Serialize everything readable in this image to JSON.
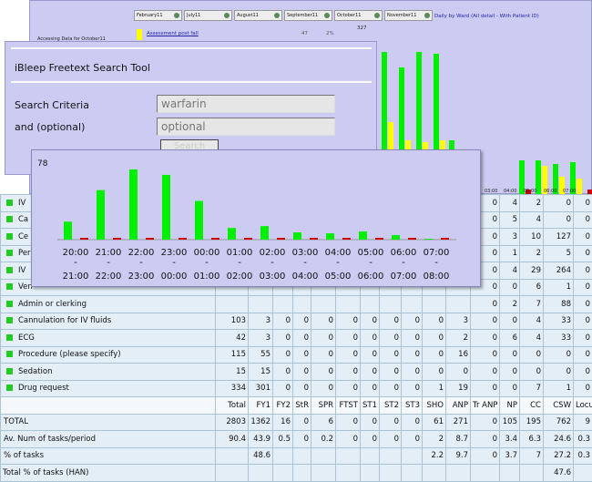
{
  "report": {
    "months": [
      "February11",
      "July11",
      "August11",
      "September11",
      "October11",
      "November11"
    ],
    "ward_link": "Daily by Ward (All detail - With Patient ID)",
    "accessing": "Accessing Data for October11",
    "legend_link": "Assessment post fall",
    "legend_count": "47",
    "legend_pct": "2%",
    "top_value": "327",
    "time_start_labels": [
      "03:00",
      "04:00",
      "05:00",
      "06:00",
      "07:00"
    ],
    "time_end_labels": [
      "04:00",
      "05:00",
      "06:00",
      "07:00",
      "08:00"
    ]
  },
  "search_tool": {
    "title": "iBleep Freetext Search Tool",
    "criteria_label": "Search Criteria",
    "criteria_value": "warfarin",
    "optional_label": "and (optional)",
    "optional_placeholder": "optional",
    "search_button": "Search"
  },
  "chart_data": {
    "type": "bar",
    "max_label": "78",
    "categories_start": [
      "20:00",
      "21:00",
      "22:00",
      "23:00",
      "00:00",
      "01:00",
      "02:00",
      "03:00",
      "04:00",
      "05:00",
      "06:00",
      "07:00"
    ],
    "categories_end": [
      "21:00",
      "22:00",
      "23:00",
      "00:00",
      "01:00",
      "02:00",
      "03:00",
      "04:00",
      "05:00",
      "06:00",
      "07:00",
      "08:00"
    ],
    "ylim": [
      0,
      78
    ],
    "series": [
      {
        "color": "#00ee00",
        "values": [
          20,
          55,
          78,
          72,
          43,
          13,
          15,
          8,
          7,
          9,
          5,
          1
        ]
      },
      {
        "color": "#ffff00",
        "values": [
          0,
          0,
          0,
          0,
          0,
          0,
          0,
          0,
          0,
          0,
          0,
          0
        ]
      },
      {
        "color": "#cc0000",
        "values": [
          1,
          1,
          1,
          1,
          1,
          1,
          1,
          1,
          1,
          1,
          1,
          1
        ]
      }
    ]
  },
  "table": {
    "columns": [
      "Total",
      "FY1",
      "FY2",
      "StR",
      "SPR",
      "FTST",
      "ST1",
      "ST2",
      "ST3",
      "SHO",
      "ANP",
      "Tr ANP",
      "NP",
      "CC",
      "CSW",
      "Locum"
    ],
    "rows": [
      {
        "label": "IV",
        "values": [
          "",
          "",
          "",
          "",
          "",
          "",
          "",
          "",
          "",
          "",
          "",
          "0",
          "4",
          "2",
          "0",
          "0"
        ]
      },
      {
        "label": "Ca",
        "values": [
          "",
          "",
          "",
          "",
          "",
          "",
          "",
          "",
          "",
          "",
          "",
          "0",
          "5",
          "4",
          "0",
          "0"
        ]
      },
      {
        "label": "Ce",
        "values": [
          "",
          "",
          "",
          "",
          "",
          "",
          "",
          "",
          "",
          "",
          "",
          "0",
          "3",
          "10",
          "127",
          "0"
        ]
      },
      {
        "label": "Per",
        "values": [
          "",
          "",
          "",
          "",
          "",
          "",
          "",
          "",
          "",
          "",
          "",
          "0",
          "1",
          "2",
          "5",
          "0"
        ]
      },
      {
        "label": "IV",
        "values": [
          "",
          "",
          "",
          "",
          "",
          "",
          "",
          "",
          "",
          "",
          "",
          "0",
          "4",
          "29",
          "264",
          "0"
        ]
      },
      {
        "label": "Ven",
        "values": [
          "",
          "",
          "",
          "",
          "",
          "",
          "",
          "",
          "",
          "",
          "",
          "0",
          "0",
          "6",
          "1",
          "0"
        ]
      },
      {
        "label": "Admin or clerking",
        "values": [
          "",
          "",
          "",
          "",
          "",
          "",
          "",
          "",
          "",
          "",
          "",
          "0",
          "2",
          "7",
          "88",
          "0"
        ]
      },
      {
        "label": "Cannulation for IV fluids",
        "values": [
          "103",
          "3",
          "0",
          "0",
          "0",
          "0",
          "0",
          "0",
          "0",
          "0",
          "3",
          "0",
          "0",
          "4",
          "33",
          "0"
        ]
      },
      {
        "label": "ECG",
        "values": [
          "42",
          "3",
          "0",
          "0",
          "0",
          "0",
          "0",
          "0",
          "0",
          "0",
          "2",
          "0",
          "6",
          "4",
          "33",
          "0"
        ]
      },
      {
        "label": "Procedure (please specify)",
        "values": [
          "115",
          "55",
          "0",
          "0",
          "0",
          "0",
          "0",
          "0",
          "0",
          "0",
          "16",
          "0",
          "0",
          "0",
          "0",
          "0"
        ]
      },
      {
        "label": "Sedation",
        "values": [
          "15",
          "15",
          "0",
          "0",
          "0",
          "0",
          "0",
          "0",
          "0",
          "0",
          "0",
          "0",
          "0",
          "0",
          "0",
          "0"
        ]
      },
      {
        "label": "Drug request",
        "values": [
          "334",
          "301",
          "0",
          "0",
          "0",
          "0",
          "0",
          "0",
          "0",
          "1",
          "19",
          "0",
          "0",
          "7",
          "1",
          "0"
        ]
      }
    ],
    "totals": {
      "label": "TOTAL",
      "values": [
        "2803",
        "1362",
        "16",
        "0",
        "6",
        "0",
        "0",
        "0",
        "0",
        "61",
        "271",
        "0",
        "105",
        "195",
        "762",
        "9"
      ]
    },
    "avg": {
      "label": "Av. Num of tasks/period",
      "values": [
        "90.4",
        "43.9",
        "0.5",
        "0",
        "0.2",
        "0",
        "0",
        "0",
        "0",
        "2",
        "8.7",
        "0",
        "3.4",
        "6.3",
        "24.6",
        "0.3"
      ]
    },
    "pct": {
      "label": "% of tasks",
      "values": [
        "",
        "48.6",
        "",
        "",
        "",
        "",
        "",
        "",
        "",
        "2.2",
        "9.7",
        "0",
        "3.7",
        "7",
        "27.2",
        "0.3"
      ]
    },
    "han": {
      "label": "Total % of tasks (HAN)",
      "values": [
        "",
        "",
        "",
        "",
        "",
        "",
        "",
        "",
        "",
        "",
        "",
        "",
        "",
        "",
        "47.6",
        ""
      ]
    }
  }
}
